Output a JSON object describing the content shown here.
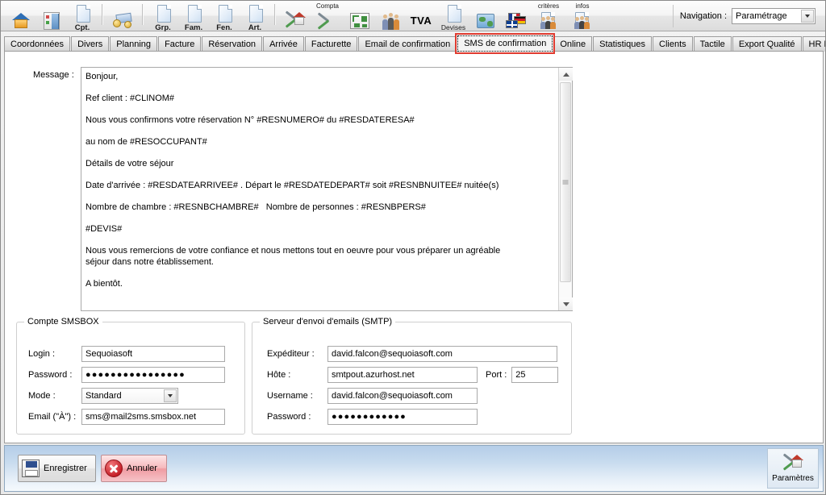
{
  "toolbar": {
    "items": [
      {
        "name": "home-icon",
        "label": "",
        "top_label": ""
      },
      {
        "name": "door-arrivals-icon",
        "label": "",
        "top_label": ""
      },
      {
        "name": "accounting-doc-icon",
        "label": "Cpt.",
        "top_label": ""
      },
      {
        "name": "payments-icon",
        "label": "",
        "top_label": ""
      },
      {
        "name": "groups-doc-icon",
        "label": "Grp.",
        "top_label": ""
      },
      {
        "name": "families-doc-icon",
        "label": "Fam.",
        "top_label": ""
      },
      {
        "name": "windows-doc-icon",
        "label": "Fen.",
        "top_label": ""
      },
      {
        "name": "articles-doc-icon",
        "label": "Art.",
        "top_label": ""
      },
      {
        "name": "settings-house-icon",
        "label": "",
        "top_label": ""
      },
      {
        "name": "compta-tools-icon",
        "label": "",
        "top_label": "Compta"
      },
      {
        "name": "floorplan-icon",
        "label": "",
        "top_label": ""
      },
      {
        "name": "clients-people-icon",
        "label": "",
        "top_label": ""
      },
      {
        "name": "tva-icon",
        "label": "TVA",
        "top_label": ""
      },
      {
        "name": "devises-doc-icon",
        "label": "Devises",
        "top_label": ""
      },
      {
        "name": "world-map-icon",
        "label": "",
        "top_label": ""
      },
      {
        "name": "languages-flags-icon",
        "label": "",
        "top_label": ""
      },
      {
        "name": "criteres-people-icon",
        "label": "",
        "top_label": "critères"
      },
      {
        "name": "infos-people-icon",
        "label": "",
        "top_label": "infos"
      }
    ],
    "navigation_label": "Navigation :",
    "navigation_value": "Paramétrage"
  },
  "tabs": [
    {
      "label": "Coordonnées",
      "active": false
    },
    {
      "label": "Divers",
      "active": false
    },
    {
      "label": "Planning",
      "active": false
    },
    {
      "label": "Facture",
      "active": false
    },
    {
      "label": "Réservation",
      "active": false
    },
    {
      "label": "Arrivée",
      "active": false
    },
    {
      "label": "Facturette",
      "active": false
    },
    {
      "label": "Email de confirmation",
      "active": false
    },
    {
      "label": "SMS de confirmation",
      "active": true
    },
    {
      "label": "Online",
      "active": false
    },
    {
      "label": "Statistiques",
      "active": false
    },
    {
      "label": "Clients",
      "active": false
    },
    {
      "label": "Tactile",
      "active": false
    },
    {
      "label": "Export Qualité",
      "active": false
    },
    {
      "label": "HR Mobile",
      "active": false
    }
  ],
  "message": {
    "label": "Message :",
    "lines": [
      "Bonjour,",
      "Ref client : #CLINOM#",
      "Nous vous confirmons votre réservation N° #RESNUMERO# du #RESDATERESA#",
      "au nom de #RESOCCUPANT#",
      "Détails de votre séjour",
      "Date d'arrivée : #RESDATEARRIVEE# . Départ le #RESDATEDEPART# soit #RESNBNUITEE# nuitée(s)",
      "Nombre de chambre : #RESNBCHAMBRE#   Nombre de personnes : #RESNBPERS#",
      "#DEVIS#",
      "Nous vous remercions de votre confiance et nous mettons tout en oeuvre pour vous préparer un agréable séjour dans notre établissement.",
      "A bientôt."
    ]
  },
  "smsbox": {
    "legend": "Compte SMSBOX",
    "login_label": "Login :",
    "login_value": "Sequoiasoft",
    "password_label": "Password :",
    "password_value": "●●●●●●●●●●●●●●●●",
    "mode_label": "Mode :",
    "mode_value": "Standard",
    "email_label": "Email (\"À\") :",
    "email_value": "sms@mail2sms.smsbox.net"
  },
  "smtp": {
    "legend": "Serveur d'envoi d'emails (SMTP)",
    "sender_label": "Expéditeur :",
    "sender_value": "david.falcon@sequoiasoft.com",
    "host_label": "Hôte :",
    "host_value": "smtpout.azurhost.net",
    "port_label": "Port :",
    "port_value": "25",
    "username_label": "Username :",
    "username_value": "david.falcon@sequoiasoft.com",
    "password_label": "Password :",
    "password_value": "●●●●●●●●●●●●"
  },
  "footer": {
    "save_label": "Enregistrer",
    "cancel_label": "Annuler",
    "params_label": "Paramètres"
  },
  "colors": {
    "active_tab_highlight": "#e03b30",
    "footer_gradient_top": "#b4cde8",
    "cancel_button": "#ef9ba2"
  }
}
